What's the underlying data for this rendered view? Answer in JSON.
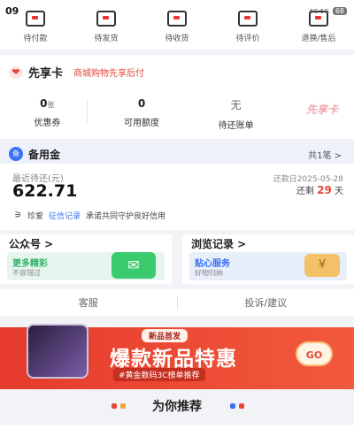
{
  "status_bar": {
    "time": "09",
    "net": "5G 5G",
    "battery": "68"
  },
  "orders": [
    {
      "label": "待付款"
    },
    {
      "label": "待发货"
    },
    {
      "label": "待收货"
    },
    {
      "label": "待评价"
    },
    {
      "label": "退换/售后"
    }
  ],
  "xxk": {
    "name": "先享卡",
    "desc": "商城购物先享后付",
    "logo_text": "先享卡",
    "stats": [
      {
        "value": "0",
        "unit": "张",
        "label": "优惠券"
      },
      {
        "value": "0",
        "unit": "",
        "label": "可用额度"
      },
      {
        "value": "无",
        "unit": "",
        "label": "待还账单"
      }
    ]
  },
  "beiyongjin": {
    "logo": "备",
    "title": "备用金",
    "count": "共1笔 >",
    "recent_label": "最近待还(元)",
    "amount": "622.71",
    "due_date": "还款日2025-05-28",
    "remain_prefix": "还剩",
    "remain_days": "29",
    "remain_suffix": "天",
    "foot_brand": "珍爱",
    "foot_link": "征信记录",
    "foot_text": "承诺共同守护良好信用"
  },
  "cards": {
    "left": {
      "title": "公众号 >",
      "inner_title": "更多精彩",
      "inner_sub": "不容错过",
      "title_color": "#2fb266"
    },
    "right": {
      "title": "浏览记录 >",
      "inner_title": "贴心服务",
      "inner_sub": "好物归纳",
      "title_color": "#3a6ff7"
    }
  },
  "service": {
    "kefu": "客服",
    "complaint": "投诉/建议"
  },
  "banner": {
    "tag": "新品首发",
    "main": "爆款新品特惠",
    "sub": "#黄金数码3C榜单推荐",
    "go": "GO"
  },
  "recommend": {
    "title": "为你推荐"
  }
}
